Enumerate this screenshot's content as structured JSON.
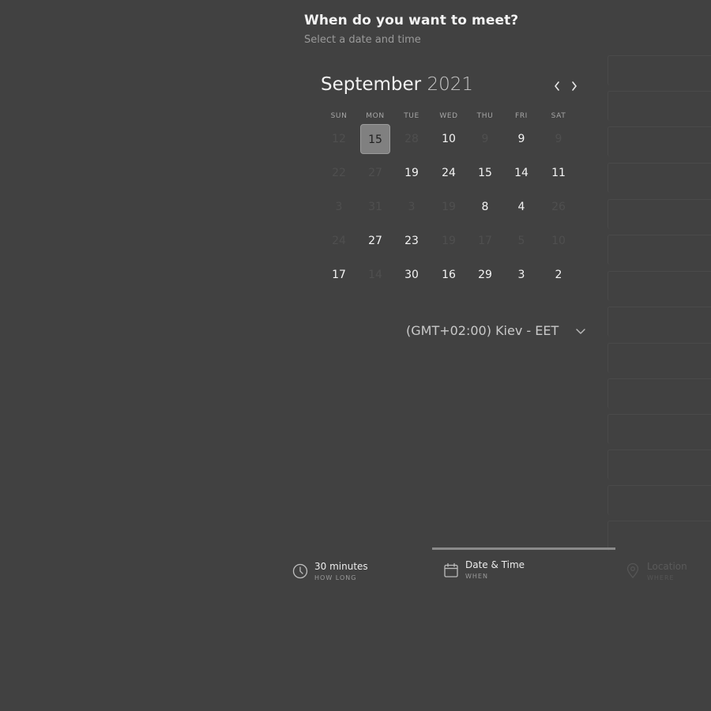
{
  "header": {
    "title": "When do you want to meet?",
    "subtitle": "Select a date and time"
  },
  "calendar": {
    "month": "September",
    "year": "2021",
    "prev_icon": "chevron-left-icon",
    "next_icon": "chevron-right-icon",
    "weekdays": [
      "SUN",
      "MON",
      "TUE",
      "WED",
      "THU",
      "FRI",
      "SAT"
    ],
    "selected_day": "15",
    "weeks": [
      [
        {
          "d": "12",
          "active": false
        },
        {
          "d": "15",
          "active": true,
          "selected": true
        },
        {
          "d": "28",
          "active": false
        },
        {
          "d": "10",
          "active": true
        },
        {
          "d": "9",
          "active": false
        },
        {
          "d": "9",
          "active": true
        },
        {
          "d": "9",
          "active": false
        }
      ],
      [
        {
          "d": "22",
          "active": false
        },
        {
          "d": "27",
          "active": false
        },
        {
          "d": "19",
          "active": true
        },
        {
          "d": "24",
          "active": true
        },
        {
          "d": "15",
          "active": true
        },
        {
          "d": "14",
          "active": true
        },
        {
          "d": "11",
          "active": true
        }
      ],
      [
        {
          "d": "3",
          "active": false
        },
        {
          "d": "31",
          "active": false
        },
        {
          "d": "3",
          "active": false
        },
        {
          "d": "19",
          "active": false
        },
        {
          "d": "8",
          "active": true
        },
        {
          "d": "4",
          "active": true
        },
        {
          "d": "26",
          "active": false
        }
      ],
      [
        {
          "d": "24",
          "active": false
        },
        {
          "d": "27",
          "active": true
        },
        {
          "d": "23",
          "active": true
        },
        {
          "d": "19",
          "active": false
        },
        {
          "d": "17",
          "active": false
        },
        {
          "d": "5",
          "active": false
        },
        {
          "d": "10",
          "active": false
        }
      ],
      [
        {
          "d": "17",
          "active": true
        },
        {
          "d": "14",
          "active": false
        },
        {
          "d": "30",
          "active": true
        },
        {
          "d": "16",
          "active": true
        },
        {
          "d": "29",
          "active": true
        },
        {
          "d": "3",
          "active": true
        },
        {
          "d": "2",
          "active": true
        }
      ]
    ]
  },
  "timezone": {
    "label": "(GMT+02:00) Kiev - EET",
    "icon": "chevron-down-icon"
  },
  "steps": [
    {
      "title": "30 minutes",
      "subtitle": "HOW LONG",
      "icon": "clock-icon",
      "state": "done"
    },
    {
      "title": "Date & Time",
      "subtitle": "WHEN",
      "icon": "calendar-icon",
      "state": "current"
    },
    {
      "title": "Location",
      "subtitle": "WHERE",
      "icon": "location-pin-icon",
      "state": "upcoming"
    }
  ],
  "colors": {
    "background": "#414141",
    "selected_day_bg": "#808080",
    "muted_text": "#4f4f4f",
    "progress": "#8a8a8a"
  }
}
